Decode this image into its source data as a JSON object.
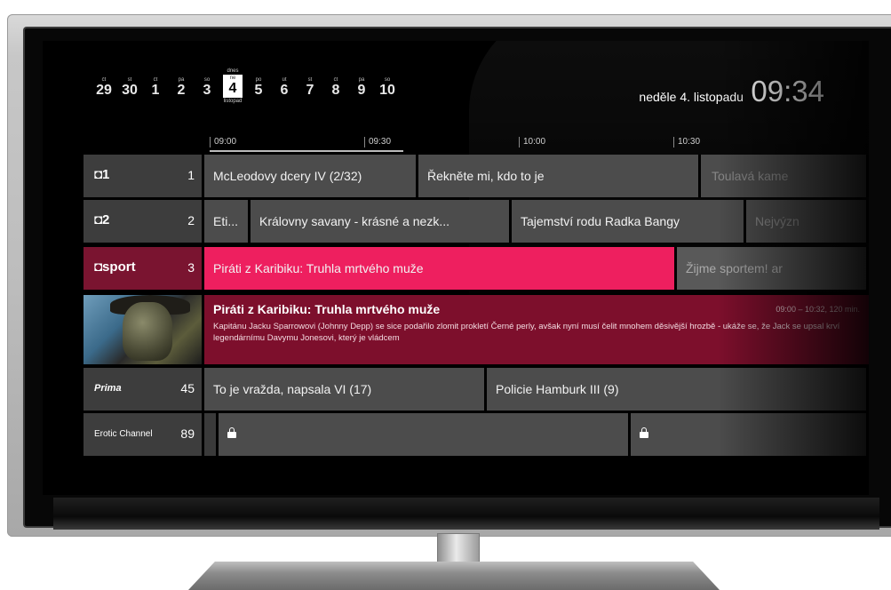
{
  "header": {
    "dates": [
      {
        "weekday": "čt",
        "day": "29"
      },
      {
        "weekday": "st",
        "day": "30"
      },
      {
        "weekday": "čt",
        "day": "1"
      },
      {
        "weekday": "pá",
        "day": "2"
      },
      {
        "weekday": "so",
        "day": "3"
      },
      {
        "weekday": "ne",
        "day": "4",
        "top": "dnes",
        "bottom": "listopad",
        "today": true
      },
      {
        "weekday": "po",
        "day": "5"
      },
      {
        "weekday": "út",
        "day": "6"
      },
      {
        "weekday": "st",
        "day": "7"
      },
      {
        "weekday": "čt",
        "day": "8"
      },
      {
        "weekday": "pá",
        "day": "9"
      },
      {
        "weekday": "so",
        "day": "10"
      }
    ],
    "current_date": "neděle 4. listopadu",
    "current_time": "09:34"
  },
  "timeline": [
    "09:00",
    "09:30",
    "10:00",
    "10:30"
  ],
  "channels": [
    {
      "logo": "◘1",
      "number": "1",
      "programs": [
        "McLeodovy dcery IV (2/32)",
        "Řekněte mi, kdo to je",
        "Toulavá kame"
      ]
    },
    {
      "logo": "◘2",
      "number": "2",
      "programs": [
        "Eti...",
        "Královny savany - krásné a nezk...",
        "Tajemství rodu Radka Bangy",
        "Nejvýzn"
      ]
    },
    {
      "logo": "◘sport",
      "number": "3",
      "programs": [
        "Piráti z Karibiku: Truhla mrtvého muže",
        "Žijme sportem! ar"
      ]
    },
    {
      "logo": "Prima",
      "number": "45",
      "programs": [
        "To je vražda, napsala VI (17)",
        "Policie Hamburk III (9)"
      ]
    },
    {
      "logo": "Erotic Channel",
      "number": "89",
      "programs": [
        "",
        ""
      ]
    }
  ],
  "detail": {
    "title": "Piráti z Karibiku: Truhla mrtvého muže",
    "time": "09:00 – 10:32, 120 min.",
    "description": "Kapitánu Jacku Sparrowovi (Johnny Depp) se sice podařilo zlomit prokletí Černé perly, avšak nyní musí čelit mnohem děsivější hrozbě - ukáže se, že Jack se upsal krví legendárnímu Davymu Jonesovi, který je vládcem"
  },
  "colors": {
    "accent": "#ee1f5f",
    "accent_dark": "#7d0f2c"
  },
  "progress_fraction": 0.294
}
